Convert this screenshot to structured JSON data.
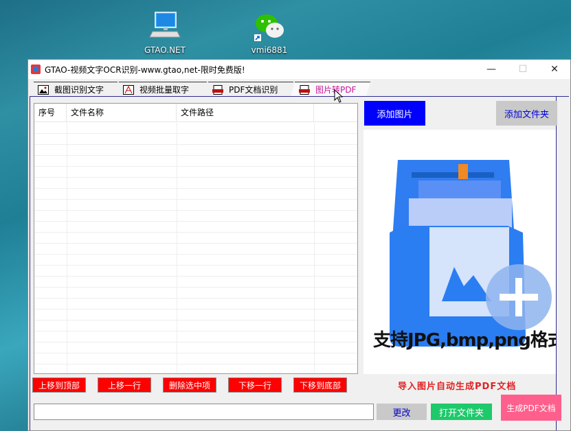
{
  "desktop": {
    "icons": [
      {
        "label": "GTAO.NET",
        "icon": "computer-icon"
      },
      {
        "label": "vmi6881",
        "icon": "wechat-icon"
      }
    ]
  },
  "window": {
    "title": "GTAO-视频文字OCR识别-www.gtao,net-限时免费版!",
    "controls": {
      "minimize": "—",
      "maximize": "☐",
      "close": "✕"
    }
  },
  "tabs": [
    {
      "label": "截图识别文字",
      "active": false
    },
    {
      "label": "视频批量取字",
      "active": false
    },
    {
      "label": "PDF文档识别",
      "active": false
    },
    {
      "label": "图片转PDF",
      "active": true
    }
  ],
  "file_list": {
    "columns": [
      "序号",
      "文件名称",
      "文件路径"
    ],
    "rows": []
  },
  "buttons": {
    "add_image": "添加图片",
    "add_folder": "添加文件夹",
    "move_top": "上移到顶部",
    "move_up": "上移一行",
    "delete_selected": "删除选中项",
    "move_down": "下移一行",
    "move_bottom": "下移到底部",
    "change": "更改",
    "open_folder": "打开文件夹",
    "generate_pdf": "生成PDF文档"
  },
  "preview": {
    "caption": "支持JPG,bmp,png格式"
  },
  "hint": "导入图片自动生成PDF文档",
  "output_path": {
    "value": "",
    "placeholder": ""
  },
  "colors": {
    "add_image_bg": "#0000ff",
    "red_buttons": "#ff0000",
    "open_folder_bg": "#1ec96b",
    "generate_pdf_bg": "#ff5f8c",
    "active_tab_text": "#c8169a",
    "hint_text": "#e02222"
  }
}
